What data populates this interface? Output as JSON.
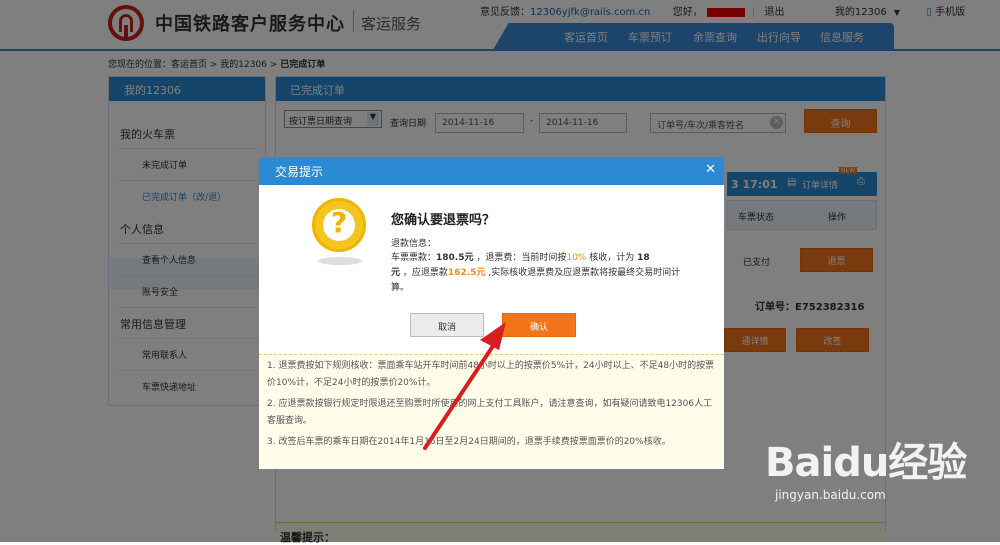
{
  "header": {
    "site_name": "中国铁路客户服务中心",
    "site_sub": "客运服务",
    "feedback_label": "意见反馈：",
    "feedback_email": "12306yjfk@rails.com.cn",
    "greeting": "您好，",
    "logout": "退出",
    "my12306": "我的12306",
    "mobile": "手机版",
    "nav": [
      "客运首页",
      "车票预订",
      "余票查询",
      "出行向导",
      "信息服务"
    ]
  },
  "breadcrumb": {
    "prefix": "您现在的位置：",
    "home": "客运首页",
    "sep1": " > ",
    "my": "我的12306",
    "sep2": " > ",
    "current": "已完成订单"
  },
  "sidebar": {
    "title": "我的12306",
    "groups": [
      {
        "label": "我的火车票",
        "items": [
          "未完成订单",
          "已完成订单（改/退）"
        ]
      },
      {
        "label": "个人信息",
        "items": [
          "查看个人信息",
          "账号安全"
        ]
      },
      {
        "label": "常用信息管理",
        "items": [
          "常用联系人",
          "车票快递地址"
        ]
      }
    ]
  },
  "main": {
    "title": "已完成订单",
    "query_type": "按订票日期查询",
    "date_label": "查询日期",
    "date_from": "2014-11-16",
    "date_dash": "-",
    "date_to": "2014-11-16",
    "search_placeholder": "订单号/车次/乘客姓名",
    "query_button": "查询",
    "order_time": "3 17:01",
    "order_detail": "订单详情",
    "new_badge": "NEW",
    "col_status": "车票状态",
    "col_op": "操作",
    "status_value": "已支付",
    "refund_btn": "退票",
    "order_no_label": "订单号：",
    "order_no": "E752382316",
    "detail_btn": "通详情",
    "change_btn": "改签",
    "warm_tip": "温馨提示："
  },
  "dialog": {
    "title": "交易提示",
    "question": "您确认要退票吗？",
    "info_label": "退款信息：",
    "line1_a": "车票票款：",
    "fare": "180.5元",
    "line1_b": " ，退票费：当前时间按",
    "rate": "10%",
    "line1_c": " 核收，计为 ",
    "fee": "18",
    "line2_a": "元",
    "line2_b": " ，应退票款",
    "refund_amount": "162.5元",
    "line2_c": " ,实际核收退票费及应退票款将按最终交易时间计算。",
    "cancel": "取消",
    "confirm": "确认"
  },
  "notice": [
    "1. 退票费按如下规则核收：票面乘车站开车时间前48小时以上的按票价5%计，24小时以上、不足48小时的按票价10%计，不足24小时的按票价20%计。",
    "2. 应退票款按银行规定时限退还至购票时所使用的网上支付工具账户，请注意查询，如有疑问请致电12306人工客服查询。",
    "3. 改签后车票的乘车日期在2014年1月16日至2月24日期间的，退票手续费按票面票价的20%核收。"
  ],
  "watermark": {
    "text": "Baidu经验",
    "url": "jingyan.baidu.com"
  },
  "colors": {
    "blue": "#2b8ad3",
    "orange": "#f2751a",
    "red": "#c8201c"
  }
}
